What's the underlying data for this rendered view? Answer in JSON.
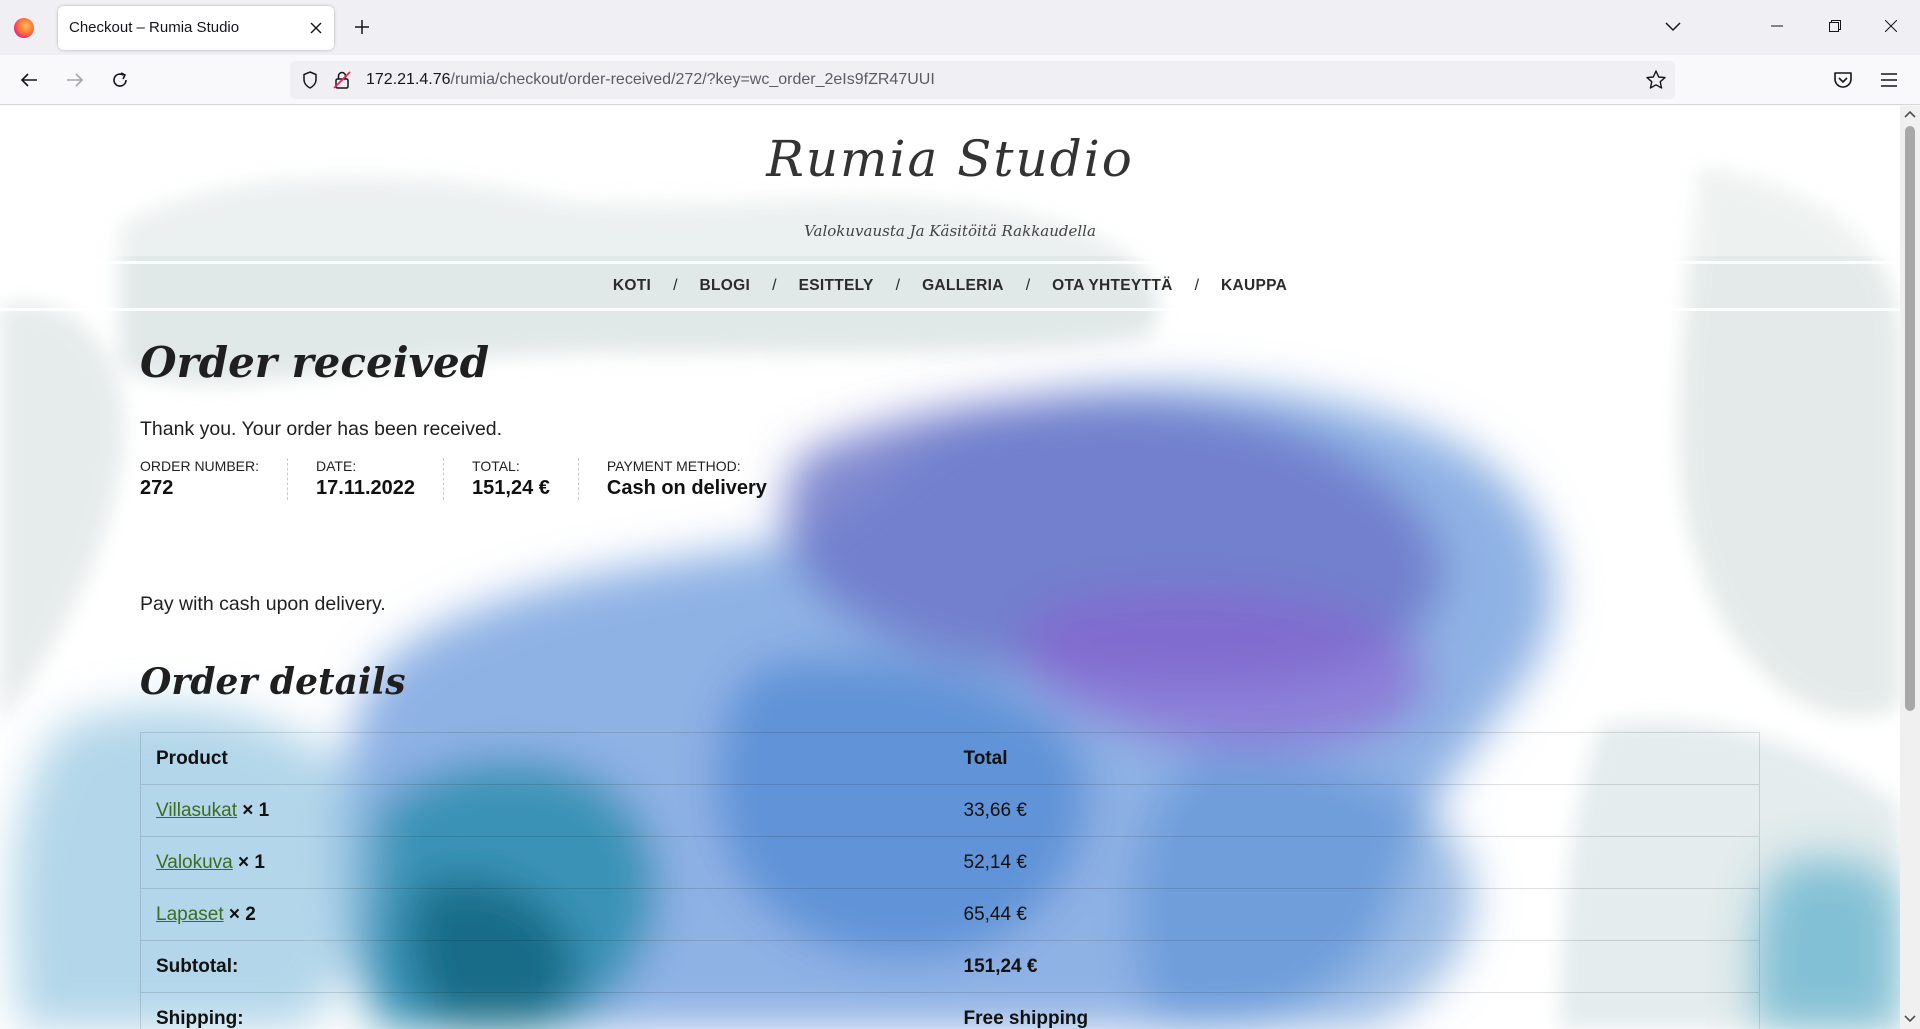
{
  "browser": {
    "tab_title": "Checkout – Rumia Studio",
    "url_host": "172.21.4.76",
    "url_path": "/rumia/checkout/order-received/272/?key=wc_order_2eIs9fZR47UUI"
  },
  "site": {
    "title": "Rumia Studio",
    "tagline": "Valokuvausta Ja Käsitöitä Rakkaudella",
    "nav": [
      "KOTI",
      "BLOGI",
      "ESITTELY",
      "GALLERIA",
      "OTA YHTEYTTÄ",
      "KAUPPA"
    ],
    "nav_separator": "/"
  },
  "order": {
    "heading": "Order received",
    "thank_you": "Thank you. Your order has been received.",
    "overview": [
      {
        "label": "ORDER NUMBER:",
        "value": "272"
      },
      {
        "label": "DATE:",
        "value": "17.11.2022"
      },
      {
        "label": "TOTAL:",
        "value": "151,24 €"
      },
      {
        "label": "PAYMENT METHOD:",
        "value": "Cash on delivery"
      }
    ],
    "payment_note": "Pay with cash upon delivery."
  },
  "details": {
    "heading": "Order details",
    "columns": [
      "Product",
      "Total"
    ],
    "items": [
      {
        "product": "Villasukat",
        "qty": "× 1",
        "total": "33,66 €"
      },
      {
        "product": "Valokuva",
        "qty": "× 1",
        "total": "52,14 €"
      },
      {
        "product": "Lapaset",
        "qty": "× 2",
        "total": "65,44 €"
      }
    ],
    "subtotal_label": "Subtotal:",
    "subtotal_value": "151,24 €",
    "shipping_label": "Shipping:",
    "shipping_value": "Free shipping"
  },
  "colors": {
    "link_green": "#3d6b1f",
    "watercolor_blue": "#4a7fd0",
    "watercolor_purple": "#7a62c8",
    "watercolor_teal": "#1f8aa8"
  }
}
